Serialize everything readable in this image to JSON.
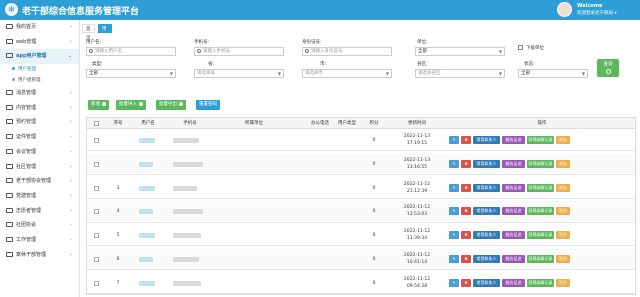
{
  "header": {
    "title": "老干部综合信息服务管理平台",
    "welcome": "Welcome",
    "user_line": "欢迎登录老干部局"
  },
  "sidebar": {
    "items": [
      {
        "label": "我的首页",
        "icon": "home-icon",
        "active": false,
        "expanded": false
      },
      {
        "label": "web管理",
        "icon": "monitor-icon",
        "active": false,
        "expanded": false
      },
      {
        "label": "app用户管理",
        "icon": "user-icon",
        "active": true,
        "expanded": true,
        "children": [
          {
            "label": "用户管理",
            "active": true
          },
          {
            "label": "用户组管理",
            "active": false
          }
        ]
      },
      {
        "label": "消息管理",
        "icon": "message-icon",
        "active": false,
        "expanded": false
      },
      {
        "label": "内容管理",
        "icon": "content-icon",
        "active": false,
        "expanded": false
      },
      {
        "label": "预约管理",
        "icon": "calendar-icon",
        "active": false,
        "expanded": false
      },
      {
        "label": "证件管理",
        "icon": "card-icon",
        "active": false,
        "expanded": false
      },
      {
        "label": "会议管理",
        "icon": "meeting-icon",
        "active": false,
        "expanded": false
      },
      {
        "label": "社区管理",
        "icon": "community-icon",
        "active": false,
        "expanded": false
      },
      {
        "label": "老干部协会管理",
        "icon": "association-icon",
        "active": false,
        "expanded": false
      },
      {
        "label": "党建管理",
        "icon": "party-icon",
        "active": false,
        "expanded": false
      },
      {
        "label": "志愿者管理",
        "icon": "volunteer-icon",
        "active": false,
        "expanded": false
      },
      {
        "label": "社团协会",
        "icon": "club-icon",
        "active": false,
        "expanded": false
      },
      {
        "label": "工作管理",
        "icon": "work-icon",
        "active": false,
        "expanded": false
      },
      {
        "label": "离休干部管理",
        "icon": "retiree-icon",
        "active": false,
        "expanded": false
      }
    ]
  },
  "tabs": [
    {
      "label": "首页",
      "active": false
    },
    {
      "label": "用户管理",
      "active": true
    }
  ],
  "filters": {
    "username_label": "用户名:",
    "username_placeholder": "请输入用户名",
    "phone_label": "手机号:",
    "phone_placeholder": "请输入手机号",
    "idcard_label": "身份证号:",
    "idcard_placeholder": "请输入身份证号",
    "unit_label": "单位:",
    "unit_value": "全部",
    "subunit_label": "下级单位",
    "type_label": "类型:",
    "type_value": "全部",
    "province_label": "省:",
    "province_value": "请选择省",
    "city_label": "市:",
    "city_value": "请选择市",
    "district_label": "县区:",
    "district_value": "请选择县区",
    "status_label": "状态:",
    "status_value": "全部",
    "search_label": "查询"
  },
  "toolbar": {
    "add": "新增",
    "batch_import": "批量导入",
    "batch_export": "批量导出",
    "reset_password": "重置密码"
  },
  "colors": {
    "header": "#2e9fd6",
    "btn_green": "#5cb85c",
    "btn_blue": "#2e9fd6",
    "btn_edit": "#4a9fd1",
    "btn_delete": "#d9534f",
    "btn_contact": "#337ab7",
    "btn_orange": "#f0ad4e",
    "btn_purple": "#9b59b6"
  },
  "table": {
    "columns": [
      "序号",
      "用户名",
      "手机号",
      "所属单位",
      "办公电话",
      "用户类型",
      "积分",
      "更新时间",
      "操作"
    ],
    "rows": [
      {
        "index": "",
        "score": "0",
        "date": "2022-11-13",
        "time": "17:19:15"
      },
      {
        "index": "",
        "score": "0",
        "date": "2022-11-13",
        "time": "13:16:55"
      },
      {
        "index": "3",
        "score": "0",
        "date": "2022-11-12",
        "time": "21:12:39"
      },
      {
        "index": "4",
        "score": "0",
        "date": "2022-11-12",
        "time": "13:53:03"
      },
      {
        "index": "5",
        "score": "0",
        "date": "2022-11-12",
        "time": "11:39:34"
      },
      {
        "index": "6",
        "score": "0",
        "date": "2022-11-12",
        "time": "10:41:14"
      },
      {
        "index": "7",
        "score": "0",
        "date": "2022-11-12",
        "time": "09:54:28"
      }
    ],
    "actions": [
      "编辑",
      "删除",
      "常用联系人",
      "服务足迹",
      "获得勋章记录",
      "积分"
    ]
  }
}
